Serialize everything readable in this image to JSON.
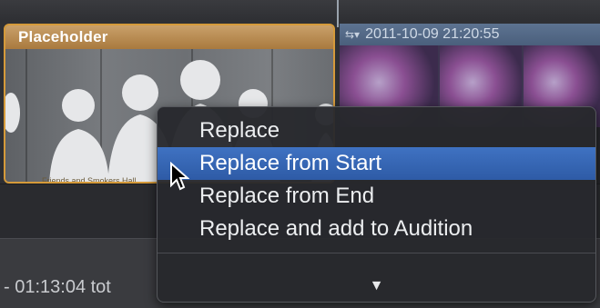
{
  "placeholder_clip": {
    "title": "Placeholder",
    "caption": "Friends and Smokers Hall"
  },
  "video_clip": {
    "icon": "audition-icon",
    "timestamp": "2011-10-09 21:20:55"
  },
  "timecode": "- 01:13:04 tot",
  "context_menu": {
    "items": [
      {
        "label": "Replace",
        "highlighted": false
      },
      {
        "label": "Replace from Start",
        "highlighted": true
      },
      {
        "label": "Replace from End",
        "highlighted": false
      },
      {
        "label": "Replace and add to Audition",
        "highlighted": false
      }
    ],
    "scroll_arrow": "▼"
  },
  "colors": {
    "highlight": "#3f72c2",
    "placeholder_border": "#d59a3a",
    "video_header": "#5d7391"
  }
}
